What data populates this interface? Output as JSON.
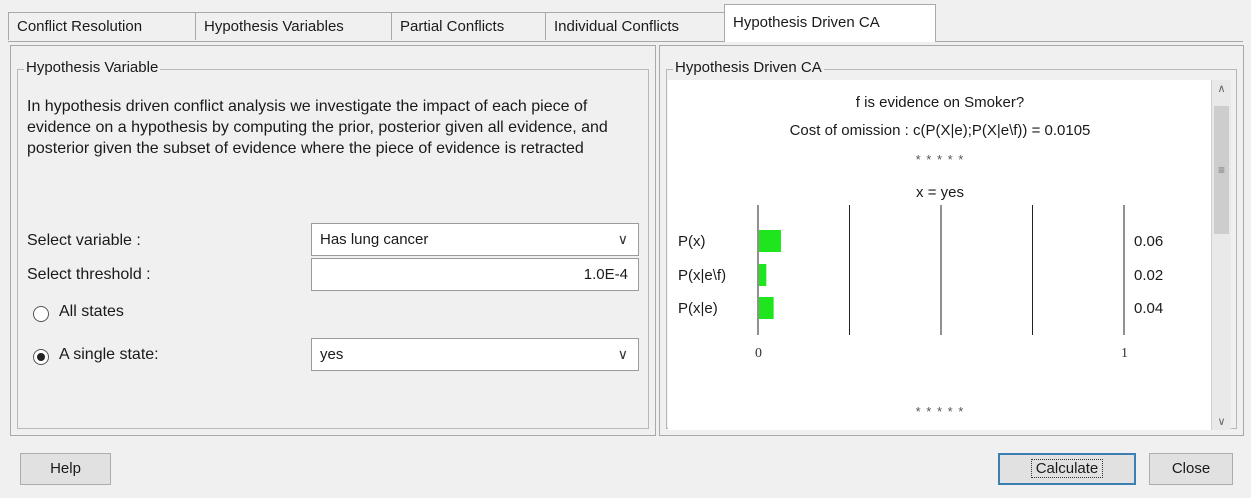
{
  "tabs": [
    {
      "label": "Conflict Resolution"
    },
    {
      "label": "Hypothesis Variables"
    },
    {
      "label": "Partial Conflicts"
    },
    {
      "label": "Individual Conflicts"
    },
    {
      "label": "Hypothesis Driven CA"
    }
  ],
  "active_tab": "Hypothesis Driven CA",
  "left": {
    "group_title": "Hypothesis Variable",
    "description": "In hypothesis driven conflict analysis we investigate the impact of each piece of evidence on a hypothesis by computing the prior, posterior given all evidence, and posterior given the subset of evidence where the piece of evidence is retracted",
    "select_variable_label": "Select variable :",
    "select_variable_value": "Has lung cancer",
    "select_threshold_label": "Select threshold :",
    "threshold_value": "1.0E-4",
    "all_states_label": "All states",
    "single_state_label": "A single state:",
    "single_state_value": "yes",
    "selected_mode": "single"
  },
  "right": {
    "group_title": "Hypothesis Driven CA",
    "question": "f is evidence on Smoker?",
    "cost_line": "Cost of omission : c(P(X|e);P(X|e\\f)) = 0.0105",
    "separator": "* * * * *",
    "state_line": "x = yes",
    "bars": [
      {
        "label": "P(x)",
        "value": 0.06,
        "value_text": "0.06"
      },
      {
        "label": "P(x|e\\f)",
        "value": 0.02,
        "value_text": "0.02"
      },
      {
        "label": "P(x|e)",
        "value": 0.04,
        "value_text": "0.04"
      }
    ],
    "axis_min": "0",
    "axis_max": "1",
    "bar_color": "#1ee51e"
  },
  "footer": {
    "help": "Help",
    "calculate": "Calculate",
    "close": "Close"
  }
}
